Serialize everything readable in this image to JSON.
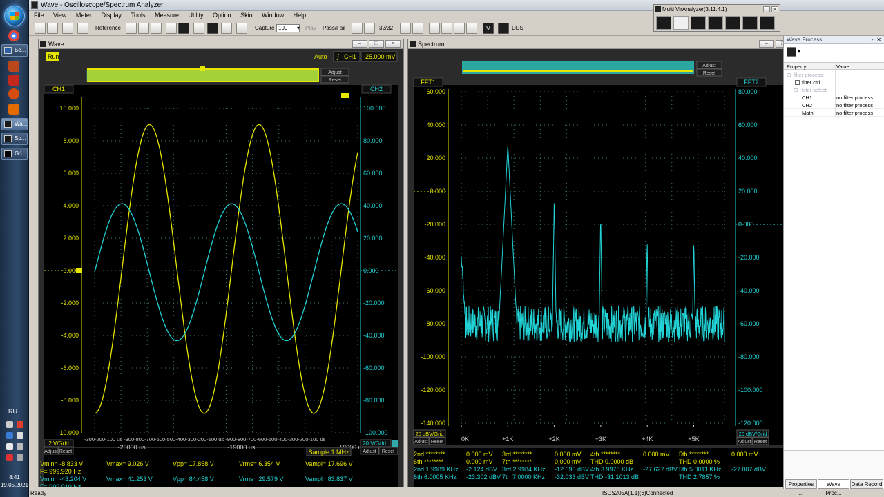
{
  "app": {
    "title": "Wave - Oscilloscope/Spectrum Analyzer",
    "menu": [
      "File",
      "View",
      "Meter",
      "Display",
      "Tools",
      "Measure",
      "Utility",
      "Option",
      "Skin",
      "Window",
      "Help"
    ],
    "toolbar": {
      "reference": "Reference",
      "capture": "Capture",
      "capture_value": "100",
      "play": "Play",
      "pass_fail": "Pass/Fail",
      "frame": "32/32",
      "dds": "DDS"
    },
    "status_left": "Ready",
    "status_right": "ISDS205A(1.1)(6)Connected"
  },
  "taskbar": {
    "buttons": [
      "Бе...",
      "Wa...",
      "Sp...",
      "G:\\"
    ],
    "lang": "RU",
    "time": "8:41",
    "date": "19.05.2021"
  },
  "colors": {
    "ch1": "#e6e600",
    "ch2": "#22d3d6",
    "grid": "#3c7a7a",
    "bg": "#000000"
  },
  "wave": {
    "title": "Wave",
    "run_label": "Run",
    "trigger_mode": "Auto",
    "trigger_channel": "CH1",
    "trigger_level": "-25.000 mV",
    "adjust": "Adjust",
    "reset": "Reset",
    "ch1_label": "CH1",
    "ch2_label": "CH2",
    "ch1_scale": "2 V/Grid",
    "ch2_scale": "20 V/Grid",
    "sample": "Sample 1 MHz",
    "left_ticks": [
      "10.000",
      "8.000",
      "6.000",
      "4.000",
      "2.000",
      "0.000",
      "-2.000",
      "-4.000",
      "-6.000",
      "-8.000",
      "-10.000"
    ],
    "right_ticks": [
      "100.000",
      "80.000",
      "60.000",
      "40.000",
      "20.000",
      "0.000",
      "-20.000",
      "-40.000",
      "-60.000",
      "-80.000",
      "-100.000"
    ],
    "time_ticks": "-300-200-100 us -900-800-700-600-500-400-300-200-100 us -900-800-700-600-500-400-300-200-100 us",
    "time_major": [
      "-20000 us",
      "-19000 us",
      "-18000 us"
    ],
    "meas_ch1": {
      "vmin": "Vmin= -8.833 V",
      "vmax": "Vmax= 9.026 V",
      "vpp": "Vpp= 17.858 V",
      "vrms": "Vrms= 6.354 V",
      "vampl": "Vampl= 17.696 V",
      "freq": "F= 999.920 Hz"
    },
    "meas_ch2": {
      "vmin": "Vmin= -43.204 V",
      "vmax": "Vmax= 41.253 V",
      "vpp": "Vpp= 84.458 V",
      "vrms": "Vrms= 29.579 V",
      "vampl": "Vampl= 83.837 V",
      "freq": "F= 999.910 Hz"
    }
  },
  "spectrum": {
    "title": "Spectrum",
    "fft1_label": "FFT1",
    "fft2_label": "FFT2",
    "adjust": "Adjust",
    "reset": "Reset",
    "fft1_scale": "20 dBV/Grid",
    "fft2_scale": "20 dBV/Grid",
    "left_ticks": [
      "60.000",
      "40.000",
      "20.000",
      "0.000",
      "-20.000",
      "-40.000",
      "-60.000",
      "-80.000",
      "-100.000",
      "-120.000",
      "-140.000"
    ],
    "right_ticks": [
      "80.000",
      "60.000",
      "40.000",
      "20.000",
      "0.000",
      "-20.000",
      "-40.000",
      "-60.000",
      "-80.000",
      "-100.000",
      "-120.000"
    ],
    "freq_ticks": [
      "0K",
      "+1K",
      "+2K",
      "+3K",
      "+4K",
      "+5K"
    ],
    "harmonics": {
      "r1": [
        "2nd ********",
        "0.000 mV",
        "3rd ********",
        "0.000 mV",
        "4th ********",
        "0.000 mV",
        "5th ********",
        "0.000 mV"
      ],
      "r2": [
        "6th ********",
        "0.000 mV",
        "7th ********",
        "0.000 mV",
        "THD  0.0000 dB",
        "",
        "THD  0.0000 %",
        ""
      ],
      "r3": [
        "2nd 1.9989 KHz",
        "-2.124 dBV",
        "3rd 2.9984 KHz",
        "-12.690 dBV",
        "4th 3.9978 KHz",
        "-27.627 dBV",
        "5th 5.0011 KHz",
        "-27.007 dBV"
      ],
      "r4": [
        "6th 6.0005 KHz",
        "-23.302 dBV",
        "7th 7.0000 KHz",
        "-32.033 dBV",
        "THD  -31.1013 dB",
        "",
        "THD  2.7857 %",
        ""
      ]
    }
  },
  "multi": {
    "title": "Multi VirAnalyzer(3.11.4.1)"
  },
  "wave_process": {
    "title": "Wave Process",
    "header_property": "Property",
    "header_value": "Value",
    "filter_process": "filter process",
    "filter_ctrl": "filter ctrl",
    "filter_select": "filter select",
    "rows": [
      {
        "name": "CH1",
        "value": "no filter process"
      },
      {
        "name": "CH2",
        "value": "no filter process"
      },
      {
        "name": "Math",
        "value": "no filter process"
      }
    ],
    "tabs": [
      "Properties ...",
      "Wave Proc...",
      "Data Record"
    ]
  },
  "chart_data": [
    {
      "type": "line",
      "title": "Wave",
      "x_label": "us",
      "xlim": [
        -20300,
        -17900
      ],
      "ylim_left": [
        -10,
        10
      ],
      "ylim_right": [
        -100,
        100
      ],
      "series": [
        {
          "name": "CH1",
          "axis": "left",
          "frequency_hz": 999.92,
          "amplitude_v": 8.9,
          "offset_v": 0.1,
          "peak_times_us": [
            -19800,
            -18800
          ]
        },
        {
          "name": "CH2",
          "axis": "right",
          "frequency_hz": 999.91,
          "amplitude_v": 42.2,
          "offset_v": -1.0,
          "peak_times_us": [
            -20050,
            -19450,
            -18450
          ]
        }
      ]
    },
    {
      "type": "line",
      "title": "Spectrum",
      "ylim_left": [
        -140,
        60
      ],
      "ylim_right": [
        -120,
        80
      ],
      "x_ticks": [
        "0K",
        "+1K",
        "+2K",
        "+3K",
        "+4K",
        "+5K"
      ],
      "series": [
        {
          "name": "FFT1",
          "peaks_khz": [
            1.0,
            1.9989,
            2.9984,
            3.9978,
            5.0011
          ],
          "peaks_db": [
            28,
            -2.124,
            -12.69,
            -27.627,
            -27.007
          ],
          "noise_floor_db": -80
        }
      ]
    }
  ]
}
